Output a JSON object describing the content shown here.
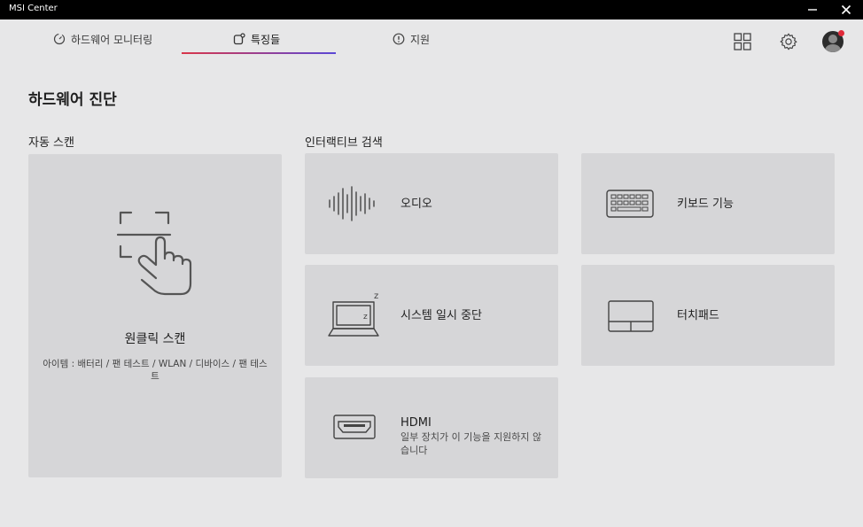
{
  "window": {
    "title": "MSI Center"
  },
  "tabs": [
    {
      "label": "하드웨어 모니터링",
      "icon": "gauge-icon",
      "active": false
    },
    {
      "label": "특징들",
      "icon": "features-icon",
      "active": true
    },
    {
      "label": "지원",
      "icon": "alert-circle-icon",
      "active": false
    }
  ],
  "toolbar": {
    "icons": [
      "grid-icon",
      "gear-icon",
      "avatar"
    ]
  },
  "page": {
    "title": "하드웨어 진단"
  },
  "auto_scan": {
    "section_label": "자동 스캔",
    "card_label": "원클릭 스캔",
    "items_desc": "아이템 : 배터리 / 팬 테스트 / WLAN / 디바이스 / 팬 테스트"
  },
  "interactive": {
    "section_label": "인터랙티브 검색",
    "cards": [
      {
        "label": "오디오",
        "icon": "waveform-icon"
      },
      {
        "label": "키보드 기능",
        "icon": "keyboard-icon"
      },
      {
        "label": "시스템 일시 중단",
        "icon": "laptop-sleep-icon"
      },
      {
        "label": "터치패드",
        "icon": "touchpad-icon"
      },
      {
        "label": "HDMI",
        "sub": "일부 장치가 이 기능을 지원하지 않습니다",
        "icon": "hdmi-icon"
      }
    ]
  },
  "colors": {
    "tab_underline_start": "#d9364a",
    "tab_underline_end": "#5b48d6",
    "notify": "#e02a3a"
  }
}
